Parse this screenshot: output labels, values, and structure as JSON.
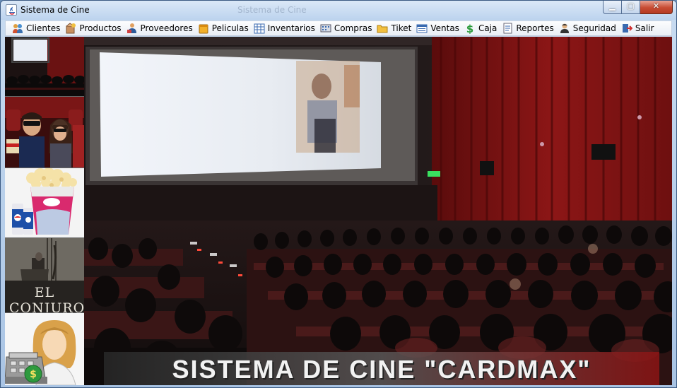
{
  "window": {
    "title": "Sistema de Cine",
    "ghost_title": "Sistema de Cine"
  },
  "menu": [
    {
      "label": "Clientes",
      "icon": "clients-icon"
    },
    {
      "label": "Productos",
      "icon": "products-icon"
    },
    {
      "label": "Proveedores",
      "icon": "suppliers-icon"
    },
    {
      "label": "Peliculas",
      "icon": "movies-icon"
    },
    {
      "label": "Inventarios",
      "icon": "inventory-icon"
    },
    {
      "label": "Compras",
      "icon": "purchases-icon"
    },
    {
      "label": "Tiket",
      "icon": "folder-icon"
    },
    {
      "label": "Ventas",
      "icon": "sales-icon"
    },
    {
      "label": "Caja",
      "icon": "cash-icon"
    },
    {
      "label": "Reportes",
      "icon": "reports-icon"
    },
    {
      "label": "Seguridad",
      "icon": "security-icon"
    },
    {
      "label": "Salir",
      "icon": "exit-icon"
    }
  ],
  "sidebar": {
    "thumbs": [
      {
        "name": "cinema-audience-thumb"
      },
      {
        "name": "3d-glasses-audience-thumb"
      },
      {
        "name": "popcorn-soda-thumb"
      },
      {
        "name": "el-conjuro-poster-thumb",
        "poster_title": "EL CONJURO"
      },
      {
        "name": "cashier-thumb"
      }
    ]
  },
  "hero": {
    "banner": "SISTEMA DE CINE  \"CARDMAX\""
  },
  "colors": {
    "title_bar": "#c9dcf1",
    "close_button": "#c74b33",
    "curtain_red": "#8c1616",
    "screen": "#e8ecf2"
  }
}
